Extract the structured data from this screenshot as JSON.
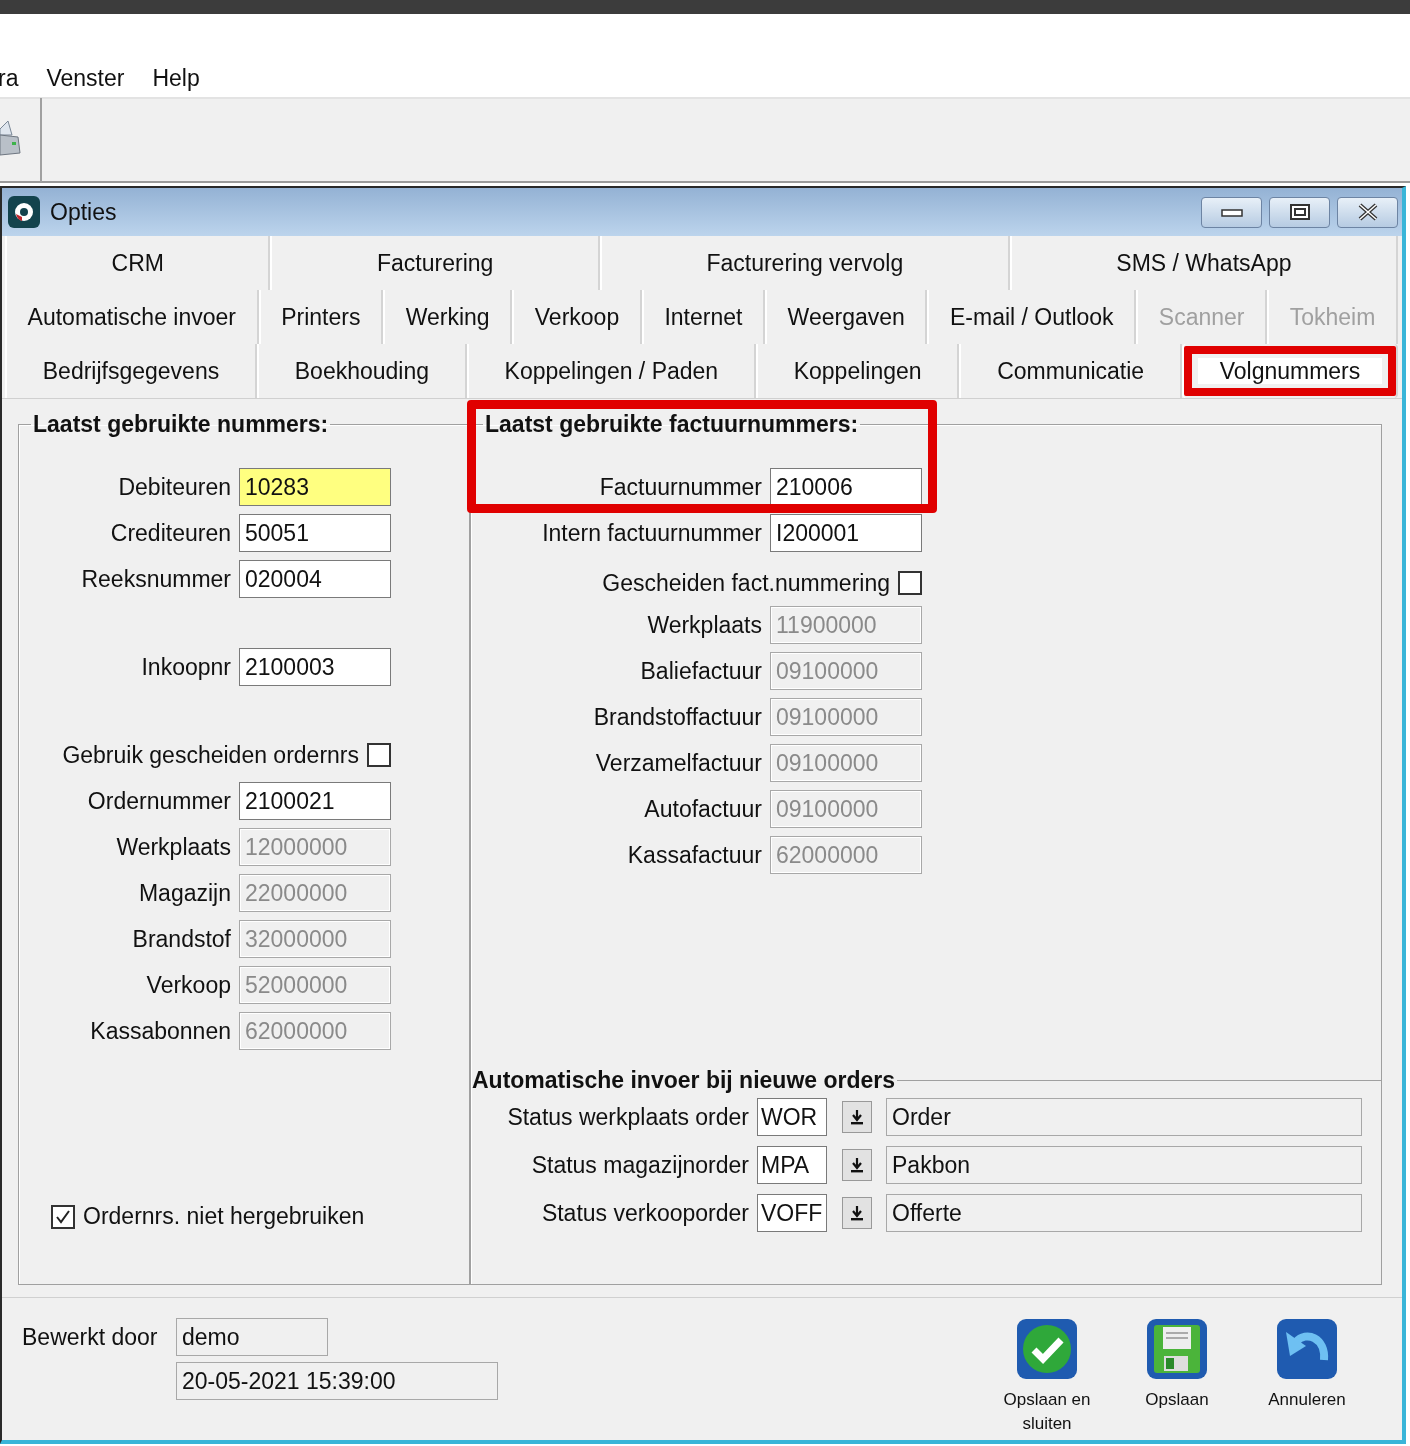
{
  "menu_bar": {
    "items": [
      "ra",
      "Venster",
      "Help"
    ]
  },
  "window": {
    "title": "Opties"
  },
  "tab_rows": [
    [
      {
        "label": "CRM",
        "selected": false,
        "disabled": false,
        "highlighted": false
      },
      {
        "label": "Facturering",
        "selected": false,
        "disabled": false,
        "highlighted": false
      },
      {
        "label": "Facturering vervolg",
        "selected": false,
        "disabled": false,
        "highlighted": false
      },
      {
        "label": "SMS / WhatsApp",
        "selected": false,
        "disabled": false,
        "highlighted": false
      }
    ],
    [
      {
        "label": "Automatische invoer",
        "selected": false,
        "disabled": false,
        "highlighted": false
      },
      {
        "label": "Printers",
        "selected": false,
        "disabled": false,
        "highlighted": false
      },
      {
        "label": "Werking",
        "selected": false,
        "disabled": false,
        "highlighted": false
      },
      {
        "label": "Verkoop",
        "selected": false,
        "disabled": false,
        "highlighted": false
      },
      {
        "label": "Internet",
        "selected": false,
        "disabled": false,
        "highlighted": false
      },
      {
        "label": "Weergaven",
        "selected": false,
        "disabled": false,
        "highlighted": false
      },
      {
        "label": "E-mail / Outlook",
        "selected": false,
        "disabled": false,
        "highlighted": false
      },
      {
        "label": "Scanner",
        "selected": false,
        "disabled": true,
        "highlighted": false
      },
      {
        "label": "Tokheim",
        "selected": false,
        "disabled": true,
        "highlighted": false
      }
    ],
    [
      {
        "label": "Bedrijfsgegevens",
        "selected": false,
        "disabled": false,
        "highlighted": false
      },
      {
        "label": "Boekhouding",
        "selected": false,
        "disabled": false,
        "highlighted": false
      },
      {
        "label": "Koppelingen / Paden",
        "selected": false,
        "disabled": false,
        "highlighted": false
      },
      {
        "label": "Koppelingen",
        "selected": false,
        "disabled": false,
        "highlighted": false
      },
      {
        "label": "Communicatie",
        "selected": false,
        "disabled": false,
        "highlighted": false
      },
      {
        "label": "Volgnummers",
        "selected": true,
        "disabled": false,
        "highlighted": true
      }
    ]
  ],
  "left_group": {
    "title": "Laatst gebruikte nummers:",
    "sections": [
      [
        {
          "kind": "text",
          "label": "Debiteuren",
          "value": "10283",
          "disabled": false,
          "focused": true
        },
        {
          "kind": "text",
          "label": "Crediteuren",
          "value": "50051",
          "disabled": false,
          "focused": false
        },
        {
          "kind": "text",
          "label": "Reeksnummer",
          "value": "020004",
          "disabled": false,
          "focused": false
        }
      ],
      [
        {
          "kind": "text",
          "label": "Inkoopnr",
          "value": "2100003",
          "disabled": false,
          "focused": false
        }
      ],
      [
        {
          "kind": "checkbox",
          "label": "Gebruik gescheiden ordernrs",
          "checked": false
        },
        {
          "kind": "text",
          "label": "Ordernummer",
          "value": "2100021",
          "disabled": false,
          "focused": false
        },
        {
          "kind": "text",
          "label": "Werkplaats",
          "value": "12000000",
          "disabled": true,
          "focused": false
        },
        {
          "kind": "text",
          "label": "Magazijn",
          "value": "22000000",
          "disabled": true,
          "focused": false
        },
        {
          "kind": "text",
          "label": "Brandstof",
          "value": "32000000",
          "disabled": true,
          "focused": false
        },
        {
          "kind": "text",
          "label": "Verkoop",
          "value": "52000000",
          "disabled": true,
          "focused": false
        },
        {
          "kind": "text",
          "label": "Kassabonnen",
          "value": "62000000",
          "disabled": true,
          "focused": false
        }
      ]
    ],
    "footer_checkbox": {
      "label": "Ordernrs. niet hergebruiken",
      "checked": true
    }
  },
  "right_group": {
    "title": "Laatst gebruikte factuurnummers:",
    "highlighted": true,
    "fields": [
      {
        "kind": "text",
        "label": "Factuurnummer",
        "value": "210006",
        "disabled": false,
        "focused": false
      },
      {
        "kind": "text",
        "label": "Intern factuurnummer",
        "value": "I200001",
        "disabled": false,
        "focused": false
      },
      {
        "kind": "checkbox",
        "label": "Gescheiden fact.nummering",
        "checked": false
      },
      {
        "kind": "text",
        "label": "Werkplaats",
        "value": "11900000",
        "disabled": true,
        "focused": false
      },
      {
        "kind": "text",
        "label": "Baliefactuur",
        "value": "09100000",
        "disabled": true,
        "focused": false
      },
      {
        "kind": "text",
        "label": "Brandstoffactuur",
        "value": "09100000",
        "disabled": true,
        "focused": false
      },
      {
        "kind": "text",
        "label": "Verzamelfactuur",
        "value": "09100000",
        "disabled": true,
        "focused": false
      },
      {
        "kind": "text",
        "label": "Autofactuur",
        "value": "09100000",
        "disabled": true,
        "focused": false
      },
      {
        "kind": "text",
        "label": "Kassafactuur",
        "value": "62000000",
        "disabled": true,
        "focused": false
      }
    ]
  },
  "auto_group": {
    "title": "Automatische invoer bij nieuwe orders",
    "rows": [
      {
        "label": "Status werkplaats order",
        "code": "WOR",
        "description": "Order"
      },
      {
        "label": "Status magazijnorder",
        "code": "MPA",
        "description": "Pakbon"
      },
      {
        "label": "Status verkooporder",
        "code": "VOFF",
        "description": "Offerte"
      }
    ]
  },
  "edited_by": {
    "label": "Bewerkt door",
    "user": "demo",
    "timestamp": "20-05-2021 15:39:00"
  },
  "buttons": [
    {
      "label": "Opslaan en sluiten"
    },
    {
      "label": "Opslaan"
    },
    {
      "label": "Annuleren"
    }
  ]
}
